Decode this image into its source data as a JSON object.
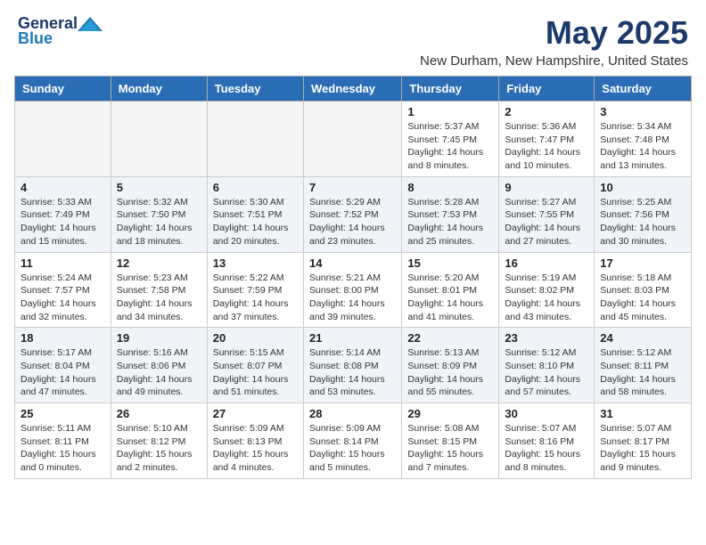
{
  "header": {
    "logo_general": "General",
    "logo_blue": "Blue",
    "month_title": "May 2025",
    "location": "New Durham, New Hampshire, United States"
  },
  "days_of_week": [
    "Sunday",
    "Monday",
    "Tuesday",
    "Wednesday",
    "Thursday",
    "Friday",
    "Saturday"
  ],
  "weeks": [
    {
      "days": [
        {
          "num": "",
          "empty": true
        },
        {
          "num": "",
          "empty": true
        },
        {
          "num": "",
          "empty": true
        },
        {
          "num": "",
          "empty": true
        },
        {
          "num": "1",
          "sunrise": "5:37 AM",
          "sunset": "7:45 PM",
          "daylight": "14 hours and 8 minutes."
        },
        {
          "num": "2",
          "sunrise": "5:36 AM",
          "sunset": "7:47 PM",
          "daylight": "14 hours and 10 minutes."
        },
        {
          "num": "3",
          "sunrise": "5:34 AM",
          "sunset": "7:48 PM",
          "daylight": "14 hours and 13 minutes."
        }
      ]
    },
    {
      "days": [
        {
          "num": "4",
          "sunrise": "5:33 AM",
          "sunset": "7:49 PM",
          "daylight": "14 hours and 15 minutes."
        },
        {
          "num": "5",
          "sunrise": "5:32 AM",
          "sunset": "7:50 PM",
          "daylight": "14 hours and 18 minutes."
        },
        {
          "num": "6",
          "sunrise": "5:30 AM",
          "sunset": "7:51 PM",
          "daylight": "14 hours and 20 minutes."
        },
        {
          "num": "7",
          "sunrise": "5:29 AM",
          "sunset": "7:52 PM",
          "daylight": "14 hours and 23 minutes."
        },
        {
          "num": "8",
          "sunrise": "5:28 AM",
          "sunset": "7:53 PM",
          "daylight": "14 hours and 25 minutes."
        },
        {
          "num": "9",
          "sunrise": "5:27 AM",
          "sunset": "7:55 PM",
          "daylight": "14 hours and 27 minutes."
        },
        {
          "num": "10",
          "sunrise": "5:25 AM",
          "sunset": "7:56 PM",
          "daylight": "14 hours and 30 minutes."
        }
      ]
    },
    {
      "days": [
        {
          "num": "11",
          "sunrise": "5:24 AM",
          "sunset": "7:57 PM",
          "daylight": "14 hours and 32 minutes."
        },
        {
          "num": "12",
          "sunrise": "5:23 AM",
          "sunset": "7:58 PM",
          "daylight": "14 hours and 34 minutes."
        },
        {
          "num": "13",
          "sunrise": "5:22 AM",
          "sunset": "7:59 PM",
          "daylight": "14 hours and 37 minutes."
        },
        {
          "num": "14",
          "sunrise": "5:21 AM",
          "sunset": "8:00 PM",
          "daylight": "14 hours and 39 minutes."
        },
        {
          "num": "15",
          "sunrise": "5:20 AM",
          "sunset": "8:01 PM",
          "daylight": "14 hours and 41 minutes."
        },
        {
          "num": "16",
          "sunrise": "5:19 AM",
          "sunset": "8:02 PM",
          "daylight": "14 hours and 43 minutes."
        },
        {
          "num": "17",
          "sunrise": "5:18 AM",
          "sunset": "8:03 PM",
          "daylight": "14 hours and 45 minutes."
        }
      ]
    },
    {
      "days": [
        {
          "num": "18",
          "sunrise": "5:17 AM",
          "sunset": "8:04 PM",
          "daylight": "14 hours and 47 minutes."
        },
        {
          "num": "19",
          "sunrise": "5:16 AM",
          "sunset": "8:06 PM",
          "daylight": "14 hours and 49 minutes."
        },
        {
          "num": "20",
          "sunrise": "5:15 AM",
          "sunset": "8:07 PM",
          "daylight": "14 hours and 51 minutes."
        },
        {
          "num": "21",
          "sunrise": "5:14 AM",
          "sunset": "8:08 PM",
          "daylight": "14 hours and 53 minutes."
        },
        {
          "num": "22",
          "sunrise": "5:13 AM",
          "sunset": "8:09 PM",
          "daylight": "14 hours and 55 minutes."
        },
        {
          "num": "23",
          "sunrise": "5:12 AM",
          "sunset": "8:10 PM",
          "daylight": "14 hours and 57 minutes."
        },
        {
          "num": "24",
          "sunrise": "5:12 AM",
          "sunset": "8:11 PM",
          "daylight": "14 hours and 58 minutes."
        }
      ]
    },
    {
      "days": [
        {
          "num": "25",
          "sunrise": "5:11 AM",
          "sunset": "8:11 PM",
          "daylight": "15 hours and 0 minutes."
        },
        {
          "num": "26",
          "sunrise": "5:10 AM",
          "sunset": "8:12 PM",
          "daylight": "15 hours and 2 minutes."
        },
        {
          "num": "27",
          "sunrise": "5:09 AM",
          "sunset": "8:13 PM",
          "daylight": "15 hours and 4 minutes."
        },
        {
          "num": "28",
          "sunrise": "5:09 AM",
          "sunset": "8:14 PM",
          "daylight": "15 hours and 5 minutes."
        },
        {
          "num": "29",
          "sunrise": "5:08 AM",
          "sunset": "8:15 PM",
          "daylight": "15 hours and 7 minutes."
        },
        {
          "num": "30",
          "sunrise": "5:07 AM",
          "sunset": "8:16 PM",
          "daylight": "15 hours and 8 minutes."
        },
        {
          "num": "31",
          "sunrise": "5:07 AM",
          "sunset": "8:17 PM",
          "daylight": "15 hours and 9 minutes."
        }
      ]
    }
  ],
  "labels": {
    "sunrise": "Sunrise:",
    "sunset": "Sunset:",
    "daylight": "Daylight:"
  }
}
